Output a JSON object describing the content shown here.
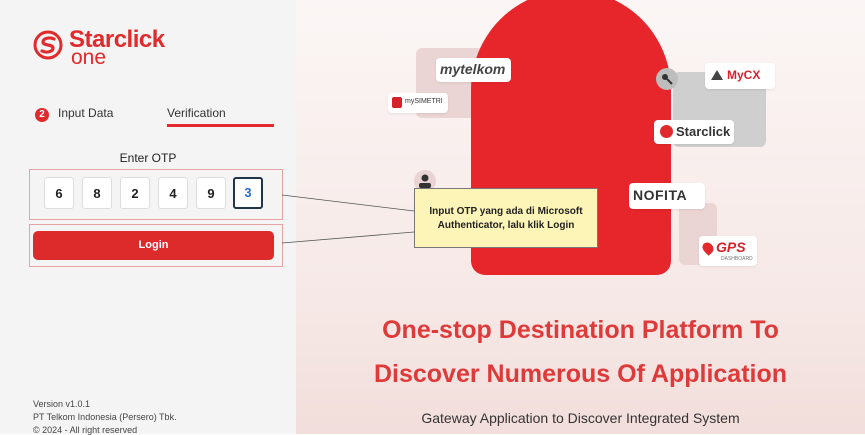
{
  "brand": {
    "name": "Starclick",
    "sub": "one",
    "color": "#e02a2b"
  },
  "steps": {
    "number": "2",
    "step1": "Input Data",
    "step2": "Verification"
  },
  "otp": {
    "label": "Enter OTP",
    "digits": [
      "6",
      "8",
      "2",
      "4",
      "9",
      "3"
    ]
  },
  "login": {
    "label": "Login"
  },
  "footer": {
    "version": "Version v1.0.1",
    "company": "PT Telkom Indonesia (Persero) Tbk.",
    "copyright": "© 2024 - All right reserved"
  },
  "apps": {
    "mytelkom": "mytelkom",
    "mysimetri": "mySIMETRI",
    "mycx": "MyCX",
    "starclick": "Starclick",
    "nofita": "NOFITA",
    "gps": "GPS",
    "gps_sub": "DASHBOARD"
  },
  "hero": {
    "line1": "One-stop Destination Platform To",
    "line2": "Discover Numerous Of Application",
    "subtitle": "Gateway Application to Discover Integrated System"
  },
  "tooltip": {
    "line1": "Input OTP yang ada di Microsoft",
    "line2": "Authenticator, lalu klik Login"
  }
}
